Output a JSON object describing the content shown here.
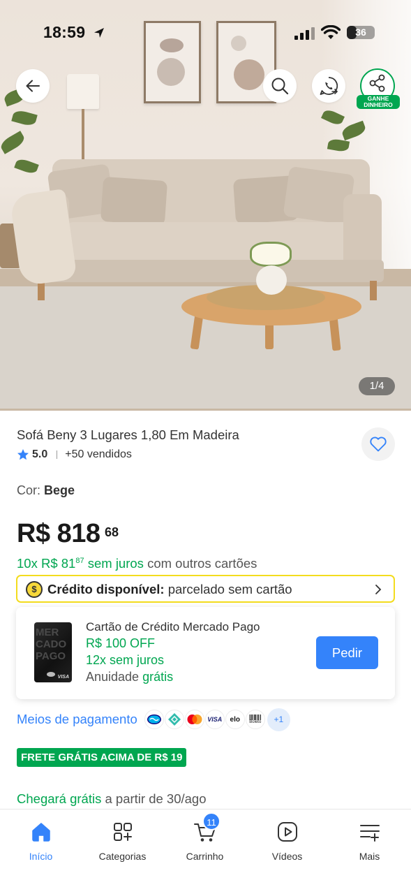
{
  "status_bar": {
    "time": "18:59",
    "battery": "36",
    "battery_level": 0.36
  },
  "hero": {
    "page_indicator": "1/4",
    "earn_badge": "GANHE DINHEIRO"
  },
  "product": {
    "title": "Sofá Beny 3 Lugares 1,80 Em Madeira",
    "rating": "5.0",
    "sold": "+50 vendidos",
    "color_label": "Cor:",
    "color_value": "Bege",
    "price_currency": "R$",
    "price_main": "R$ 818",
    "price_cents": "68",
    "installments_prefix": "10x R$ 81",
    "installments_cents": "87",
    "installments_interest": "sem juros",
    "installments_suffix": "com outros cartões"
  },
  "credit": {
    "coin": "$",
    "label": "Crédito disponível:",
    "value": "parcelado sem cartão"
  },
  "card_offer": {
    "card_letters": "MER CADO PAGO",
    "card_brand": "VISA",
    "title": "Cartão de Crédito Mercado Pago",
    "off": "R$ 100 OFF",
    "installments": "12x sem juros",
    "fee_prefix": "Anuidade",
    "fee_value": "grátis",
    "button": "Pedir"
  },
  "payments": {
    "link": "Meios de pagamento",
    "methods": [
      "mercado-pago",
      "pix",
      "mastercard",
      "visa",
      "elo",
      "boleto"
    ],
    "visa_text": "VISA",
    "elo_text": "elo",
    "boleto_text": "Boleto",
    "more": "+1"
  },
  "shipping": {
    "tag": "FRETE GRÁTIS ACIMA DE R$ 19",
    "delivery_highlight": "Chegará grátis",
    "delivery_rest": "a partir de 30/ago"
  },
  "bottom_nav": {
    "items": [
      {
        "label": "Início",
        "icon": "home-icon",
        "active": true
      },
      {
        "label": "Categorias",
        "icon": "categories-icon"
      },
      {
        "label": "Carrinho",
        "icon": "cart-icon"
      },
      {
        "label": "Vídeos",
        "icon": "video-icon"
      },
      {
        "label": "Mais",
        "icon": "more-icon"
      }
    ],
    "cart_count": "11"
  },
  "colors": {
    "accent_blue": "#3483fa",
    "green": "#00a650",
    "yellow": "#f3dc1e"
  }
}
